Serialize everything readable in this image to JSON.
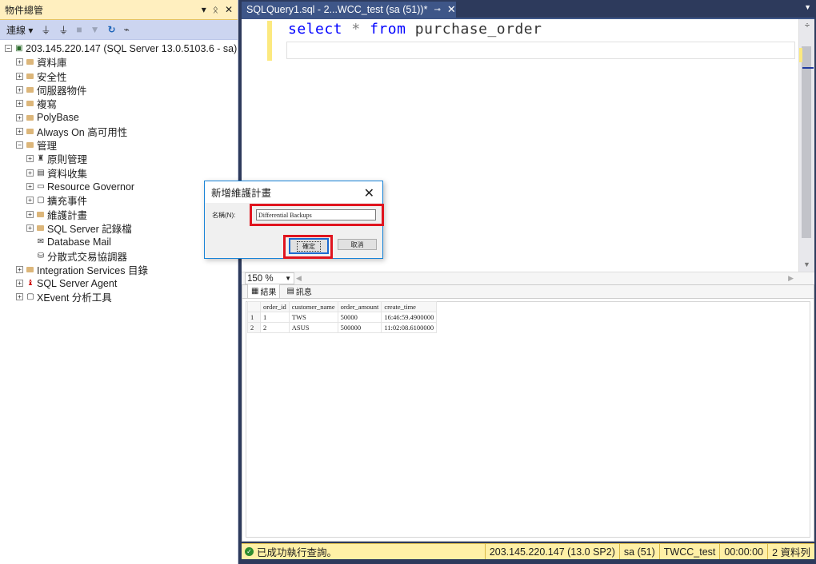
{
  "object_explorer": {
    "title": "物件總管",
    "title_buttons": [
      "▾",
      "♯",
      "✕"
    ],
    "toolbar": {
      "connect_label": "連線 ▾"
    },
    "tree": [
      {
        "label": "203.145.220.147 (SQL Server 13.0.5103.6 - sa)",
        "expander": "⊟",
        "icon": "server"
      },
      {
        "label": "資料庫",
        "expander": "⊞",
        "icon": "folder"
      },
      {
        "label": "安全性",
        "expander": "⊞",
        "icon": "folder"
      },
      {
        "label": "伺服器物件",
        "expander": "⊞",
        "icon": "folder"
      },
      {
        "label": "複寫",
        "expander": "⊞",
        "icon": "folder"
      },
      {
        "label": "PolyBase",
        "expander": "⊞",
        "icon": "folder"
      },
      {
        "label": "Always On 高可用性",
        "expander": "⊞",
        "icon": "folder"
      },
      {
        "label": "管理",
        "expander": "⊟",
        "icon": "folder"
      },
      {
        "label": "原則管理",
        "expander": "⊞",
        "icon": "policy"
      },
      {
        "label": "資料收集",
        "expander": "⊞",
        "icon": "data-collection"
      },
      {
        "label": "Resource Governor",
        "expander": "⊞",
        "icon": "resource-governor"
      },
      {
        "label": "擴充事件",
        "expander": "⊞",
        "icon": "xevent"
      },
      {
        "label": "維護計畫",
        "expander": "⊞",
        "icon": "folder"
      },
      {
        "label": "SQL Server 記錄檔",
        "expander": "⊞",
        "icon": "folder"
      },
      {
        "label": "Database Mail",
        "expander": "",
        "icon": "mail"
      },
      {
        "label": "分散式交易協調器",
        "expander": "",
        "icon": "dtc"
      },
      {
        "label": "Integration Services 目錄",
        "expander": "⊞",
        "icon": "folder"
      },
      {
        "label": "SQL Server Agent",
        "expander": "⊞",
        "icon": "agent"
      },
      {
        "label": "XEvent 分析工具",
        "expander": "⊞",
        "icon": "xevent"
      }
    ]
  },
  "editor": {
    "tab_title": "SQLQuery1.sql - 2...WCC_test (sa (51))*",
    "code": {
      "kw1": "select",
      "star": "*",
      "kw2": "from",
      "object": "purchase_order"
    },
    "zoom": "150 %"
  },
  "results": {
    "tabs": [
      "結果",
      "訊息"
    ],
    "columns": [
      "order_id",
      "customer_name",
      "order_amount",
      "create_time"
    ],
    "rows": [
      {
        "num": "1",
        "cells": [
          "1",
          "TWS",
          "50000",
          "16:46:59.4900000"
        ]
      },
      {
        "num": "2",
        "cells": [
          "2",
          "ASUS",
          "500000",
          "11:02:08.6100000"
        ]
      }
    ]
  },
  "status_bar": {
    "message": "已成功執行查詢。",
    "server": "203.145.220.147 (13.0 SP2)",
    "user": "sa (51)",
    "database": "TWCC_test",
    "elapsed": "00:00:00",
    "rows": "2 資料列"
  },
  "dialog": {
    "title": "新增維護計畫",
    "name_label": "名稱(N):",
    "name_value": "Differential Backups",
    "ok_label": "確定",
    "cancel_label": "取消"
  },
  "colors": {
    "highlight_red": "#e0141e",
    "status_yellow": "#fff0a6",
    "tab_blue": "#3e5688"
  }
}
